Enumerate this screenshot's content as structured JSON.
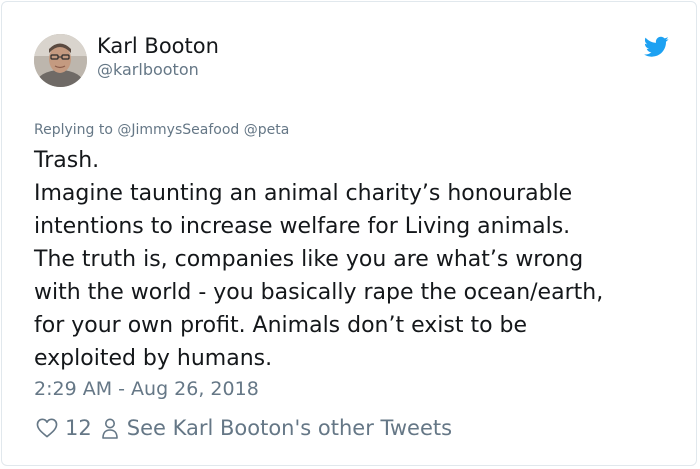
{
  "author": {
    "display_name": "Karl Booton",
    "handle": "@karlbooton",
    "avatar_icon": "user-avatar-photo"
  },
  "platform_icon": "twitter-bird-icon",
  "colors": {
    "twitter_blue": "#1da1f2",
    "text_primary": "#14171a",
    "text_secondary": "#657786"
  },
  "tweet": {
    "replying_to": "Replying to @JimmysSeafood @peta",
    "lines": [
      "Trash.",
      "Imagine taunting an animal charity’s honourable",
      "intentions to increase welfare for Living animals.",
      "The truth is, companies like you are what’s wrong",
      "with the world - you basically rape the ocean/earth,",
      "for your own profit. Animals don’t exist to be",
      "exploited by humans."
    ],
    "timestamp": "2:29 AM - Aug 26, 2018"
  },
  "actions": {
    "like_count": "12",
    "other_tweets_label": "See Karl Booton's other Tweets"
  }
}
